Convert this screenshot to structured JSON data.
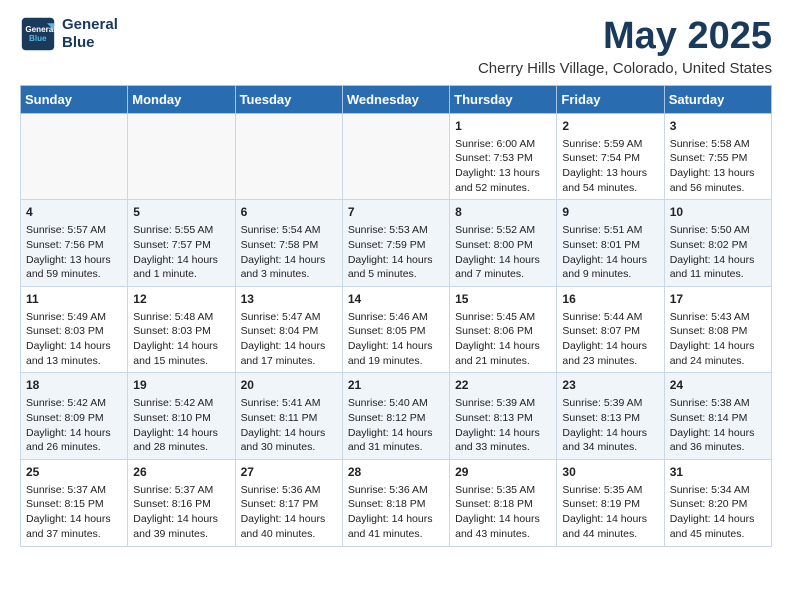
{
  "logo": {
    "line1": "General",
    "line2": "Blue"
  },
  "title": "May 2025",
  "subtitle": "Cherry Hills Village, Colorado, United States",
  "weekdays": [
    "Sunday",
    "Monday",
    "Tuesday",
    "Wednesday",
    "Thursday",
    "Friday",
    "Saturday"
  ],
  "weeks": [
    [
      {
        "day": "",
        "info": ""
      },
      {
        "day": "",
        "info": ""
      },
      {
        "day": "",
        "info": ""
      },
      {
        "day": "",
        "info": ""
      },
      {
        "day": "1",
        "info": "Sunrise: 6:00 AM\nSunset: 7:53 PM\nDaylight: 13 hours\nand 52 minutes."
      },
      {
        "day": "2",
        "info": "Sunrise: 5:59 AM\nSunset: 7:54 PM\nDaylight: 13 hours\nand 54 minutes."
      },
      {
        "day": "3",
        "info": "Sunrise: 5:58 AM\nSunset: 7:55 PM\nDaylight: 13 hours\nand 56 minutes."
      }
    ],
    [
      {
        "day": "4",
        "info": "Sunrise: 5:57 AM\nSunset: 7:56 PM\nDaylight: 13 hours\nand 59 minutes."
      },
      {
        "day": "5",
        "info": "Sunrise: 5:55 AM\nSunset: 7:57 PM\nDaylight: 14 hours\nand 1 minute."
      },
      {
        "day": "6",
        "info": "Sunrise: 5:54 AM\nSunset: 7:58 PM\nDaylight: 14 hours\nand 3 minutes."
      },
      {
        "day": "7",
        "info": "Sunrise: 5:53 AM\nSunset: 7:59 PM\nDaylight: 14 hours\nand 5 minutes."
      },
      {
        "day": "8",
        "info": "Sunrise: 5:52 AM\nSunset: 8:00 PM\nDaylight: 14 hours\nand 7 minutes."
      },
      {
        "day": "9",
        "info": "Sunrise: 5:51 AM\nSunset: 8:01 PM\nDaylight: 14 hours\nand 9 minutes."
      },
      {
        "day": "10",
        "info": "Sunrise: 5:50 AM\nSunset: 8:02 PM\nDaylight: 14 hours\nand 11 minutes."
      }
    ],
    [
      {
        "day": "11",
        "info": "Sunrise: 5:49 AM\nSunset: 8:03 PM\nDaylight: 14 hours\nand 13 minutes."
      },
      {
        "day": "12",
        "info": "Sunrise: 5:48 AM\nSunset: 8:03 PM\nDaylight: 14 hours\nand 15 minutes."
      },
      {
        "day": "13",
        "info": "Sunrise: 5:47 AM\nSunset: 8:04 PM\nDaylight: 14 hours\nand 17 minutes."
      },
      {
        "day": "14",
        "info": "Sunrise: 5:46 AM\nSunset: 8:05 PM\nDaylight: 14 hours\nand 19 minutes."
      },
      {
        "day": "15",
        "info": "Sunrise: 5:45 AM\nSunset: 8:06 PM\nDaylight: 14 hours\nand 21 minutes."
      },
      {
        "day": "16",
        "info": "Sunrise: 5:44 AM\nSunset: 8:07 PM\nDaylight: 14 hours\nand 23 minutes."
      },
      {
        "day": "17",
        "info": "Sunrise: 5:43 AM\nSunset: 8:08 PM\nDaylight: 14 hours\nand 24 minutes."
      }
    ],
    [
      {
        "day": "18",
        "info": "Sunrise: 5:42 AM\nSunset: 8:09 PM\nDaylight: 14 hours\nand 26 minutes."
      },
      {
        "day": "19",
        "info": "Sunrise: 5:42 AM\nSunset: 8:10 PM\nDaylight: 14 hours\nand 28 minutes."
      },
      {
        "day": "20",
        "info": "Sunrise: 5:41 AM\nSunset: 8:11 PM\nDaylight: 14 hours\nand 30 minutes."
      },
      {
        "day": "21",
        "info": "Sunrise: 5:40 AM\nSunset: 8:12 PM\nDaylight: 14 hours\nand 31 minutes."
      },
      {
        "day": "22",
        "info": "Sunrise: 5:39 AM\nSunset: 8:13 PM\nDaylight: 14 hours\nand 33 minutes."
      },
      {
        "day": "23",
        "info": "Sunrise: 5:39 AM\nSunset: 8:13 PM\nDaylight: 14 hours\nand 34 minutes."
      },
      {
        "day": "24",
        "info": "Sunrise: 5:38 AM\nSunset: 8:14 PM\nDaylight: 14 hours\nand 36 minutes."
      }
    ],
    [
      {
        "day": "25",
        "info": "Sunrise: 5:37 AM\nSunset: 8:15 PM\nDaylight: 14 hours\nand 37 minutes."
      },
      {
        "day": "26",
        "info": "Sunrise: 5:37 AM\nSunset: 8:16 PM\nDaylight: 14 hours\nand 39 minutes."
      },
      {
        "day": "27",
        "info": "Sunrise: 5:36 AM\nSunset: 8:17 PM\nDaylight: 14 hours\nand 40 minutes."
      },
      {
        "day": "28",
        "info": "Sunrise: 5:36 AM\nSunset: 8:18 PM\nDaylight: 14 hours\nand 41 minutes."
      },
      {
        "day": "29",
        "info": "Sunrise: 5:35 AM\nSunset: 8:18 PM\nDaylight: 14 hours\nand 43 minutes."
      },
      {
        "day": "30",
        "info": "Sunrise: 5:35 AM\nSunset: 8:19 PM\nDaylight: 14 hours\nand 44 minutes."
      },
      {
        "day": "31",
        "info": "Sunrise: 5:34 AM\nSunset: 8:20 PM\nDaylight: 14 hours\nand 45 minutes."
      }
    ]
  ]
}
